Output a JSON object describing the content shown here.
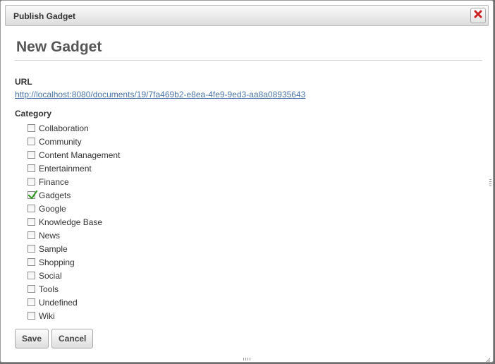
{
  "dialog": {
    "title": "Publish Gadget",
    "close_icon": "close-x-icon",
    "accent_color": "#cc2222"
  },
  "form": {
    "heading": "New Gadget",
    "url_label": "URL",
    "url_value": "http://localhost:8080/documents/19/7fa469b2-e8ea-4fe9-9ed3-aa8a08935643",
    "category_label": "Category",
    "categories": [
      {
        "label": "Collaboration",
        "checked": false
      },
      {
        "label": "Community",
        "checked": false
      },
      {
        "label": "Content Management",
        "checked": false
      },
      {
        "label": "Entertainment",
        "checked": false
      },
      {
        "label": "Finance",
        "checked": false
      },
      {
        "label": "Gadgets",
        "checked": true
      },
      {
        "label": "Google",
        "checked": false
      },
      {
        "label": "Knowledge Base",
        "checked": false
      },
      {
        "label": "News",
        "checked": false
      },
      {
        "label": "Sample",
        "checked": false
      },
      {
        "label": "Shopping",
        "checked": false
      },
      {
        "label": "Social",
        "checked": false
      },
      {
        "label": "Tools",
        "checked": false
      },
      {
        "label": "Undefined",
        "checked": false
      },
      {
        "label": "Wiki",
        "checked": false
      }
    ],
    "save_label": "Save",
    "cancel_label": "Cancel"
  },
  "colors": {
    "check_green": "#3a9a2a",
    "link": "#4a74a8"
  }
}
